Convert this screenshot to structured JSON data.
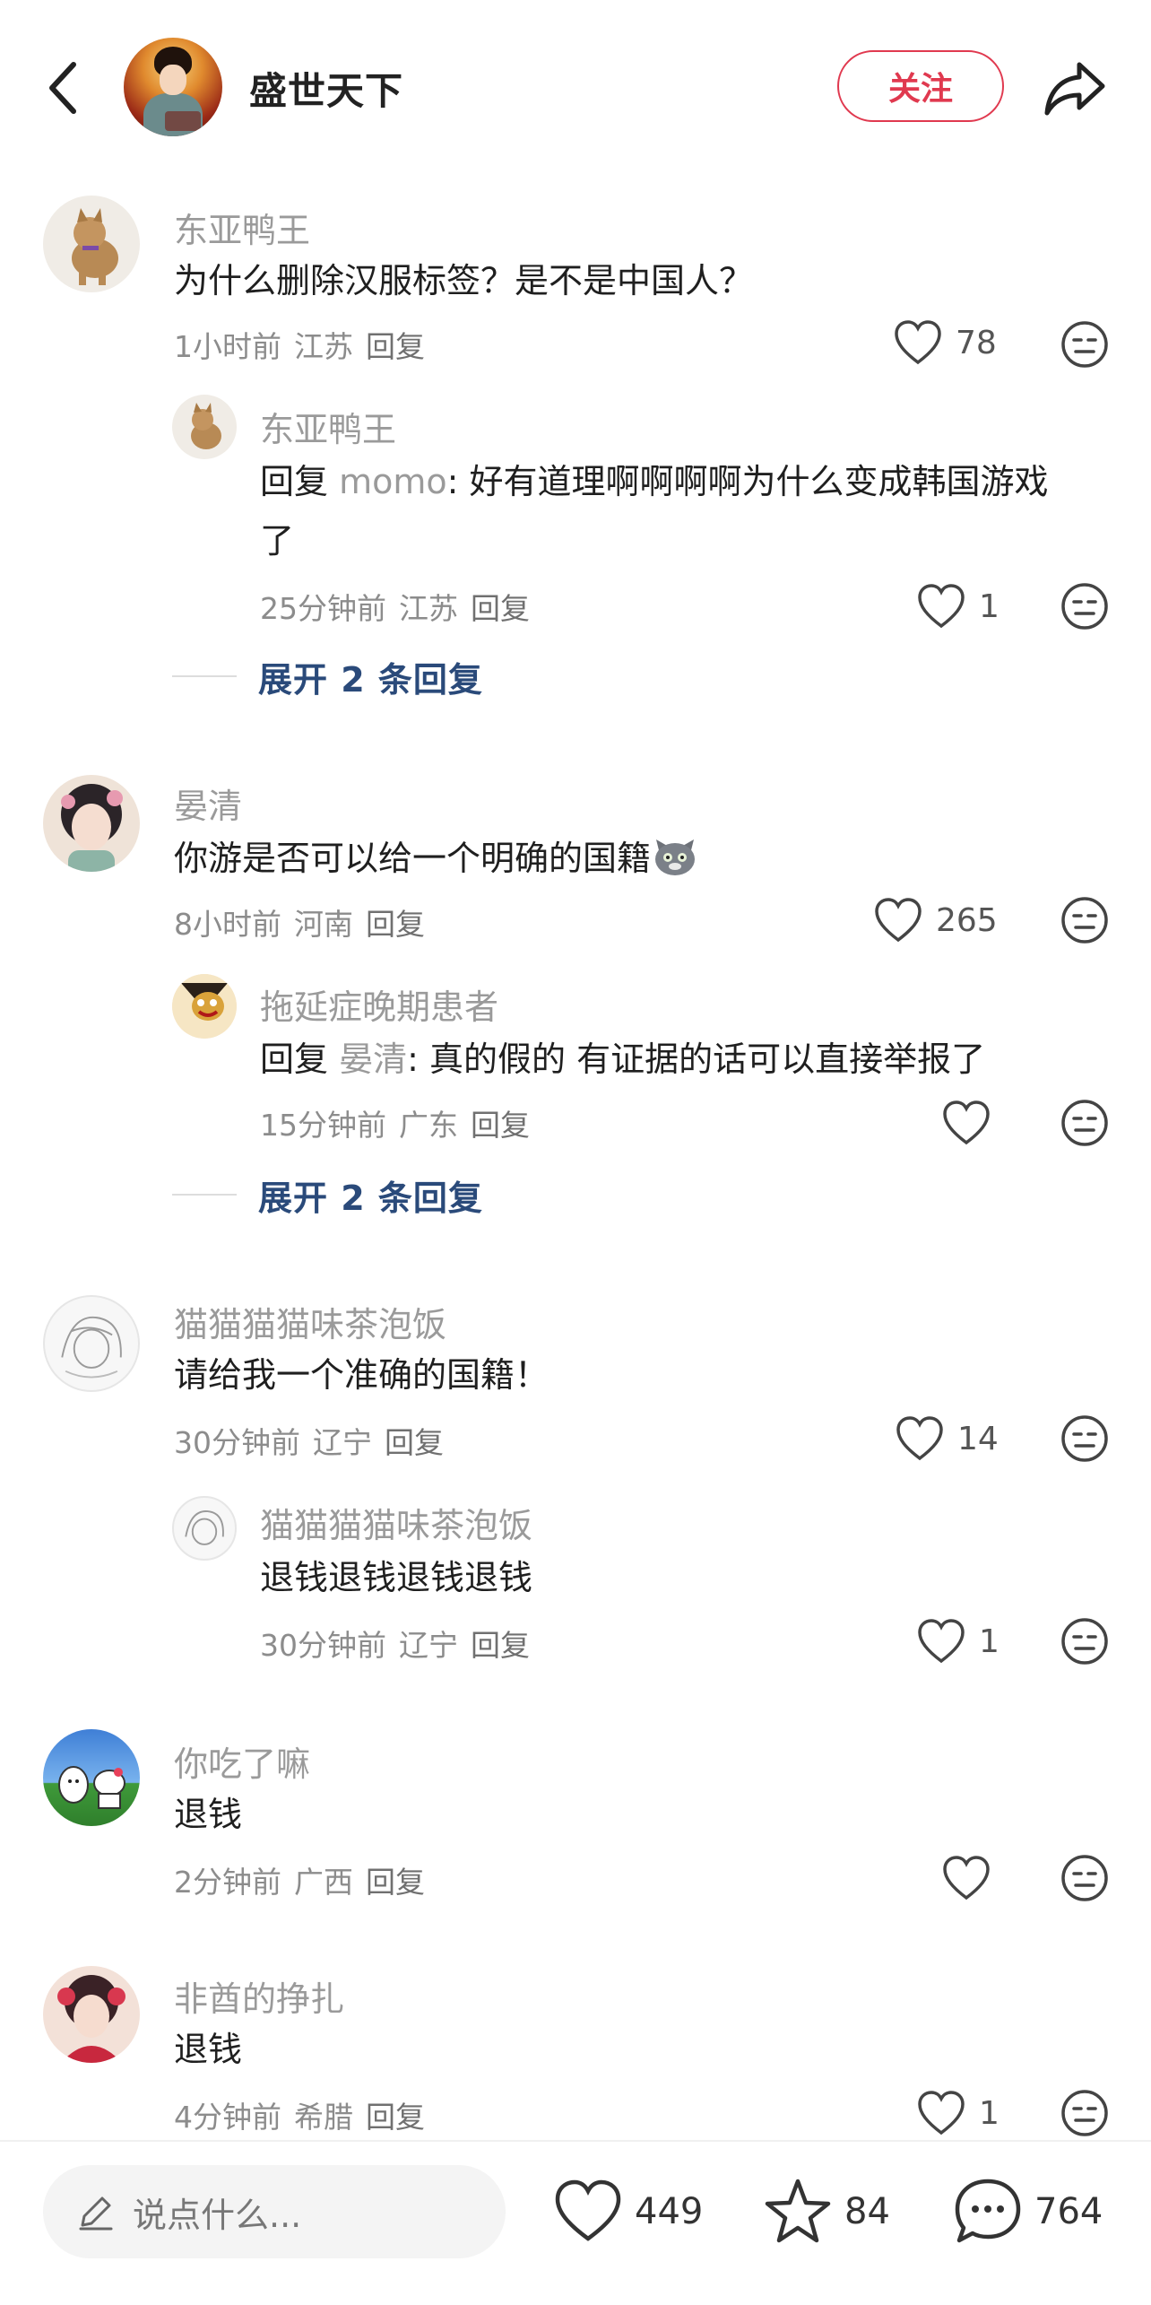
{
  "header": {
    "title": "盛世天下",
    "follow_label": "关注",
    "icons": {
      "back": "chevron-left-icon",
      "share": "share-arrow-icon"
    },
    "accent_color": "#e0394f"
  },
  "comments": [
    {
      "username": "东亚鸭王",
      "text": "为什么删除汉服标签？是不是中国人？",
      "time": "1小时前",
      "location": "江苏",
      "reply_label": "回复",
      "likes": "78",
      "reply": {
        "username": "东亚鸭王",
        "prefix": "回复 ",
        "mention": "momo",
        "text_line1": ": 好有道理啊啊啊啊为什么变成韩国游戏",
        "text_line2": "了",
        "time": "25分钟前",
        "location": "江苏",
        "reply_label": "回复",
        "likes": "1"
      },
      "expand_label": "展开 2 条回复"
    },
    {
      "username": "晏清",
      "text": "你游是否可以给一个明确的国籍",
      "time": "8小时前",
      "location": "河南",
      "reply_label": "回复",
      "likes": "265",
      "reply": {
        "username": "拖延症晚期患者",
        "prefix": "回复 ",
        "mention": "晏清",
        "text_line1": ": 真的假的 有证据的话可以直接举报了",
        "time": "15分钟前",
        "location": "广东",
        "reply_label": "回复",
        "likes": ""
      },
      "expand_label": "展开 2 条回复"
    },
    {
      "username": "猫猫猫猫味茶泡饭",
      "text": "请给我一个准确的国籍！",
      "time": "30分钟前",
      "location": "辽宁",
      "reply_label": "回复",
      "likes": "14",
      "reply": {
        "username": "猫猫猫猫味茶泡饭",
        "text_line1": "退钱退钱退钱退钱",
        "time": "30分钟前",
        "location": "辽宁",
        "reply_label": "回复",
        "likes": "1"
      }
    },
    {
      "username": "你吃了嘛",
      "text": "退钱",
      "time": "2分钟前",
      "location": "广西",
      "reply_label": "回复",
      "likes": ""
    },
    {
      "username": "非酋的挣扎",
      "text": "退钱",
      "time": "4分钟前",
      "location": "希腊",
      "reply_label": "回复",
      "likes": "1"
    }
  ],
  "bottom_bar": {
    "input_placeholder": "说点什么...",
    "likes": "449",
    "favorites": "84",
    "comments": "764",
    "icons": {
      "input": "pencil-icon",
      "likes": "heart-icon",
      "favorites": "star-icon",
      "comments": "speech-bubble-icon"
    }
  }
}
